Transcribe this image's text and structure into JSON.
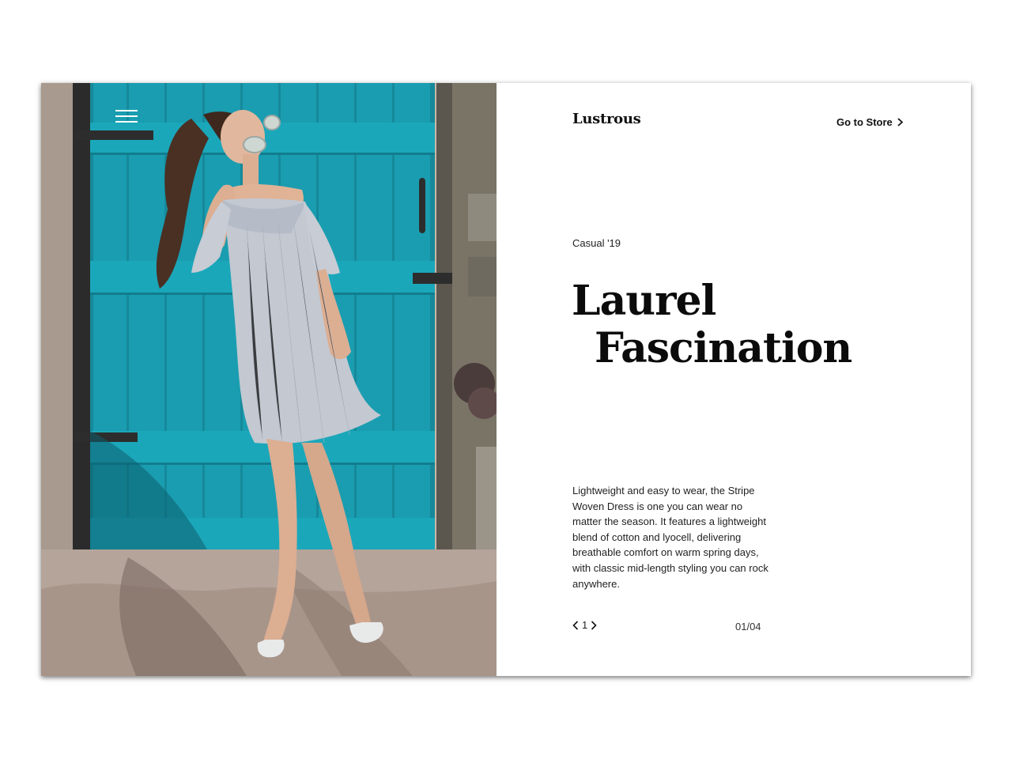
{
  "header": {
    "brand": "Lustrous",
    "store_link": "Go to Store",
    "menu_icon": "hamburger-menu-icon"
  },
  "hero": {
    "season": "Casual '19",
    "title_line1": "Laurel",
    "title_line2": "Fascination",
    "description": "Lightweight and easy to wear, the Stripe Woven Dress is one you can wear no matter the season. It features a lightweight blend of cotton and lyocell, delivering breathable comfort on warm spring days, with classic mid-length styling you can rock anywhere.",
    "image_alt": "Woman in striped off-shoulder dress in front of teal wooden door"
  },
  "pager": {
    "current": "1",
    "counter": "01/04",
    "prev_icon": "chevron-left-icon",
    "next_icon": "chevron-right-icon"
  },
  "colors": {
    "door": "#1a9db0",
    "door_dark": "#117d8e",
    "text": "#111111",
    "background": "#ffffff"
  }
}
